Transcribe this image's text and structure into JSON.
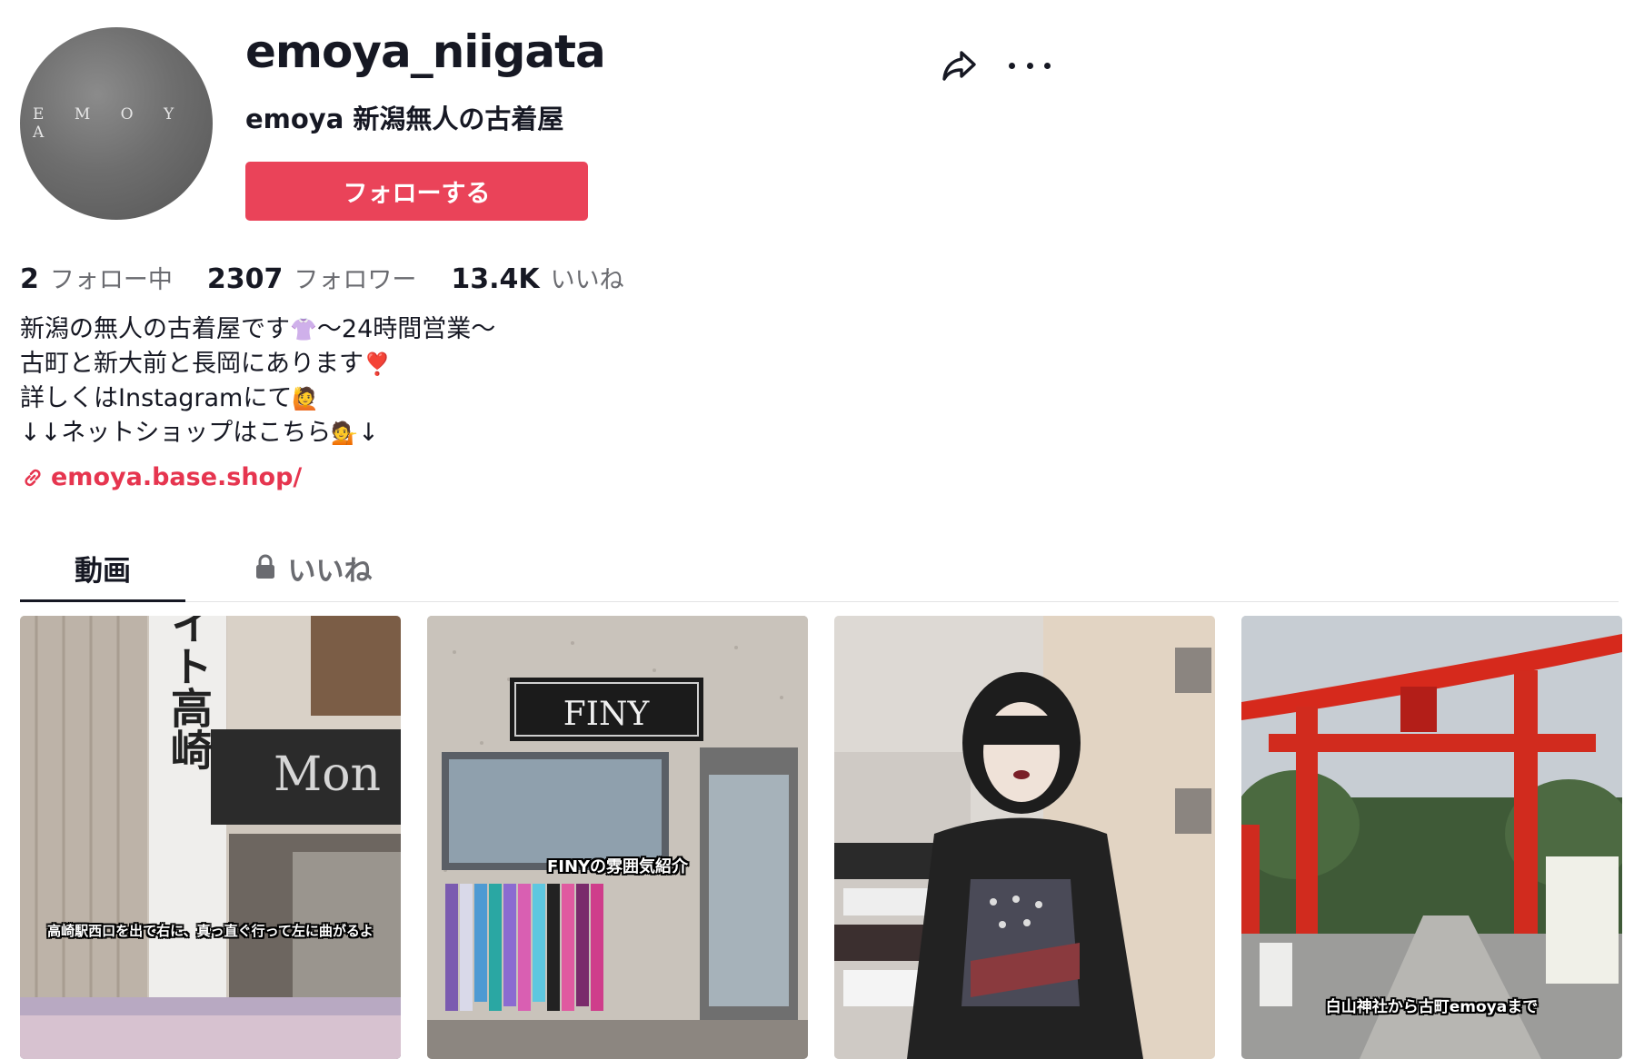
{
  "profile": {
    "avatar_text": "E M O Y A",
    "username": "emoya_niigata",
    "nickname": "emoya 新潟無人の古着屋",
    "follow_button": "フォローする"
  },
  "stats": {
    "following_count": "2",
    "following_label": "フォロー中",
    "followers_count": "2307",
    "followers_label": "フォロワー",
    "likes_count": "13.4K",
    "likes_label": "いいね"
  },
  "bio": {
    "line1": "新潟の無人の古着屋です",
    "line1_emoji": "👚",
    "line1_tail": "〜24時間営業〜",
    "line2": "古町と新大前と長岡にあります",
    "line2_emoji": "❣️",
    "line3": "詳しくはInstagramにて",
    "line3_emoji": "🙋",
    "line4": "↓↓ネットショップはこちら",
    "line4_emoji": "💁",
    "line4_tail": "↓"
  },
  "link": {
    "icon": "link-icon",
    "text": "emoya.base.shop/"
  },
  "tabs": {
    "videos": "動画",
    "liked": "いいね"
  },
  "videos": [
    {
      "caption": "高崎駅西口を出て右に、真っ直ぐ行って左に曲がるよ",
      "sign_text": "ーサイト高崎",
      "store_text": "Mon"
    },
    {
      "caption": "FINYの雰囲気紹介",
      "sign_text": "FINY"
    },
    {
      "caption": ""
    },
    {
      "caption": "白山神社から古町emoyaまで"
    }
  ],
  "colors": {
    "accent": "#ea4359",
    "link": "#e6354f",
    "text": "#161823",
    "muted": "#6a6b70"
  }
}
